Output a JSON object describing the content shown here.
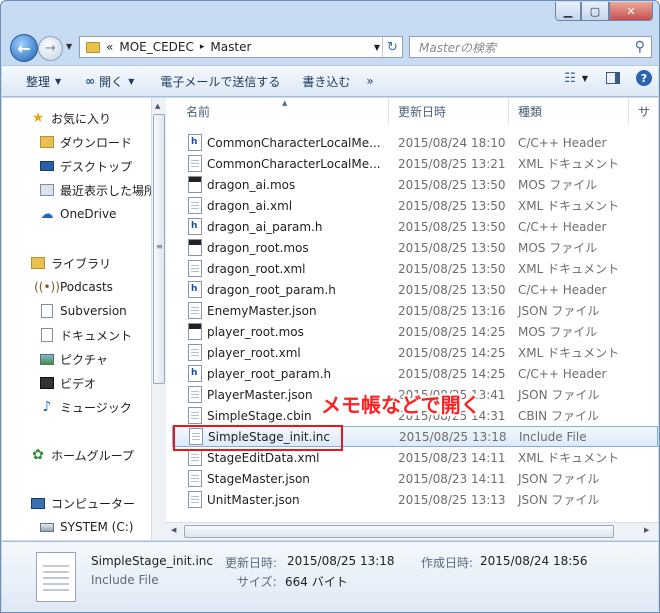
{
  "address": {
    "overflow": "«",
    "crumbs": [
      "MOE_CEDEC",
      "Master"
    ],
    "separator": "▸"
  },
  "search": {
    "placeholder": "Masterの検索"
  },
  "toolbar": {
    "organize": "整理",
    "open": "開く",
    "email": "電子メールで送信する",
    "burn": "書き込む",
    "more": "»"
  },
  "sidebar": {
    "favorites": "お気に入り",
    "downloads": "ダウンロード",
    "desktop": "デスクトップ",
    "recent": "最近表示した場所",
    "onedrive": "OneDrive",
    "libraries": "ライブラリ",
    "podcasts": "Podcasts",
    "subversion": "Subversion",
    "documents": "ドキュメント",
    "pictures": "ピクチャ",
    "videos": "ビデオ",
    "music": "ミュージック",
    "homegroup": "ホームグループ",
    "computer": "コンピューター",
    "system_c": "SYSTEM (C:)"
  },
  "columns": {
    "name": "名前",
    "date": "更新日時",
    "type": "種類",
    "size": "サ"
  },
  "files": [
    {
      "name": "CommonCharacterLocalMe...",
      "date": "2015/08/24 18:10",
      "type": "C/C++ Header",
      "icon": "header-icon"
    },
    {
      "name": "CommonCharacterLocalMe...",
      "date": "2015/08/25 13:21",
      "type": "XML ドキュメント",
      "icon": "document-icon"
    },
    {
      "name": "dragon_ai.mos",
      "date": "2015/08/25 13:50",
      "type": "MOS ファイル",
      "icon": "mos-icon"
    },
    {
      "name": "dragon_ai.xml",
      "date": "2015/08/25 13:50",
      "type": "XML ドキュメント",
      "icon": "document-icon"
    },
    {
      "name": "dragon_ai_param.h",
      "date": "2015/08/25 13:50",
      "type": "C/C++ Header",
      "icon": "header-icon"
    },
    {
      "name": "dragon_root.mos",
      "date": "2015/08/25 13:50",
      "type": "MOS ファイル",
      "icon": "mos-icon"
    },
    {
      "name": "dragon_root.xml",
      "date": "2015/08/25 13:50",
      "type": "XML ドキュメント",
      "icon": "document-icon"
    },
    {
      "name": "dragon_root_param.h",
      "date": "2015/08/25 13:50",
      "type": "C/C++ Header",
      "icon": "header-icon"
    },
    {
      "name": "EnemyMaster.json",
      "date": "2015/08/25 13:16",
      "type": "JSON ファイル",
      "icon": "document-icon"
    },
    {
      "name": "player_root.mos",
      "date": "2015/08/25 14:25",
      "type": "MOS ファイル",
      "icon": "mos-icon"
    },
    {
      "name": "player_root.xml",
      "date": "2015/08/25 14:25",
      "type": "XML ドキュメント",
      "icon": "document-icon"
    },
    {
      "name": "player_root_param.h",
      "date": "2015/08/25 14:25",
      "type": "C/C++ Header",
      "icon": "header-icon"
    },
    {
      "name": "PlayerMaster.json",
      "date": "2015/08/25 13:41",
      "type": "JSON ファイル",
      "icon": "document-icon"
    },
    {
      "name": "SimpleStage.cbin",
      "date": "2015/08/25 14:31",
      "type": "CBIN ファイル",
      "icon": "document-icon"
    },
    {
      "name": "SimpleStage_init.inc",
      "date": "2015/08/25 13:18",
      "type": "Include File",
      "icon": "text-file-icon"
    },
    {
      "name": "StageEditData.xml",
      "date": "2015/08/23 14:11",
      "type": "XML ドキュメント",
      "icon": "document-icon"
    },
    {
      "name": "StageMaster.json",
      "date": "2015/08/23 14:11",
      "type": "JSON ファイル",
      "icon": "document-icon"
    },
    {
      "name": "UnitMaster.json",
      "date": "2015/08/25 13:13",
      "type": "JSON ファイル",
      "icon": "document-icon"
    }
  ],
  "annotation": {
    "callout": "メモ帳などで開く"
  },
  "details": {
    "filename": "SimpleStage_init.inc",
    "filetype": "Include File",
    "modified_label": "更新日時:",
    "modified_value": "2015/08/25 13:18",
    "created_label": "作成日時:",
    "created_value": "2015/08/24 18:56",
    "size_label": "サイズ:",
    "size_value": "664 バイト"
  }
}
